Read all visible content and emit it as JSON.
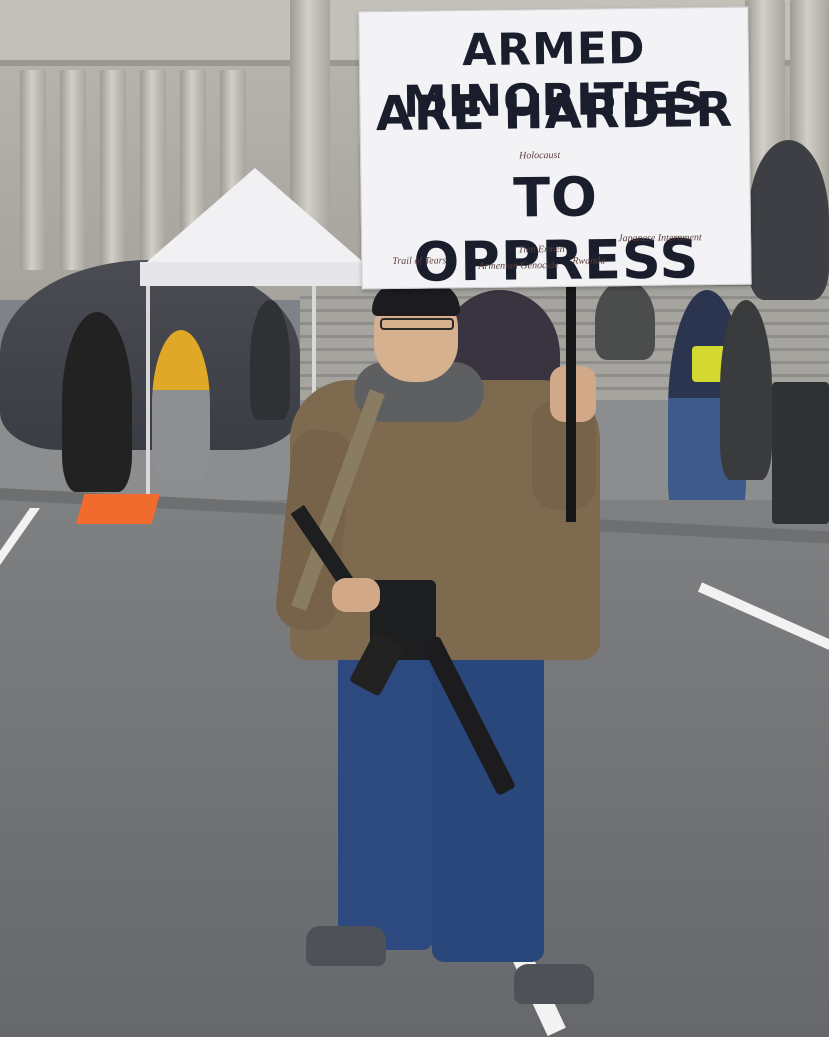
{
  "sign": {
    "line1": "ARMED MINORITIES",
    "line2": "ARE HARDER",
    "line3": "TO OPPRESS",
    "notes": [
      "Holocaust",
      "Trail of Tears",
      "Tien Ermen",
      "Japanese Internment",
      "Armenian Genocide",
      "Rwanda"
    ]
  }
}
